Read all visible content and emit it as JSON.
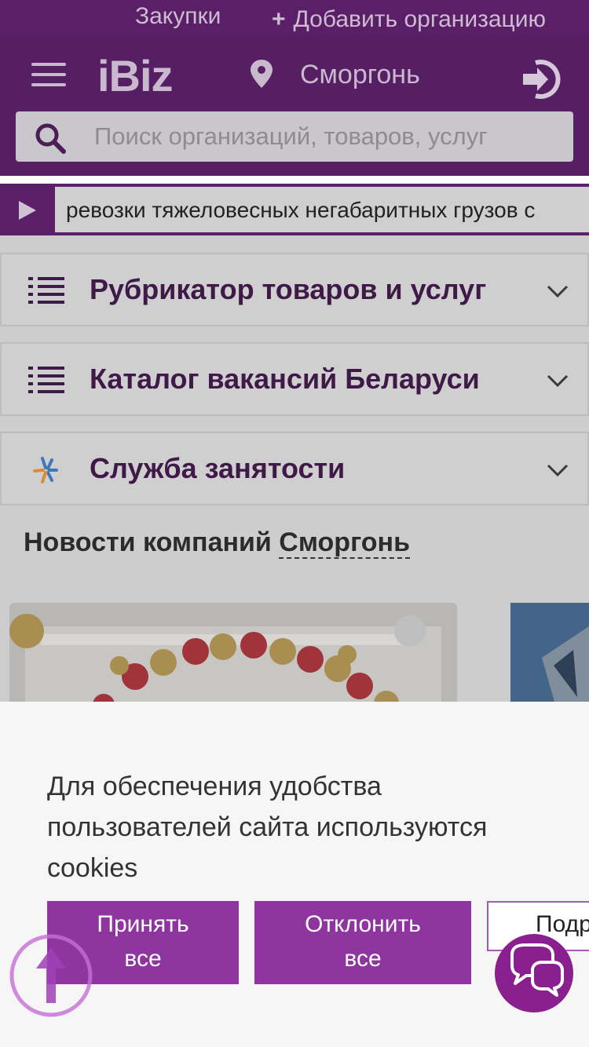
{
  "topbar": {
    "zakupki": "Закупки",
    "add_org_plus": "+",
    "add_org": "Добавить организацию"
  },
  "header": {
    "logo": "iBiz",
    "city": "Сморгонь",
    "search_placeholder": "Поиск организаций, товаров, услуг"
  },
  "ticker": {
    "text": "ревозки тяжеловесных негабаритных грузов с"
  },
  "accordions": [
    {
      "label": "Рубрикатор товаров и услуг",
      "icon": "list-icon"
    },
    {
      "label": "Каталог вакансий Беларуси",
      "icon": "list-icon"
    },
    {
      "label": "Служба занятости",
      "icon": "employment-service-logo"
    }
  ],
  "news": {
    "title_prefix": "Новости компаний",
    "city": "Сморгонь"
  },
  "cookie": {
    "message": "Для обеспечения удобства пользователей сайта используются cookies",
    "accept_line1": "Принять",
    "accept_line2": "все",
    "decline_line1": "Отклонить",
    "decline_line2": "все",
    "more": "Подр"
  },
  "colors": {
    "brand_purple": "#561f63",
    "button_purple": "#8e35a0",
    "chat_purple": "#8a1f8f"
  }
}
